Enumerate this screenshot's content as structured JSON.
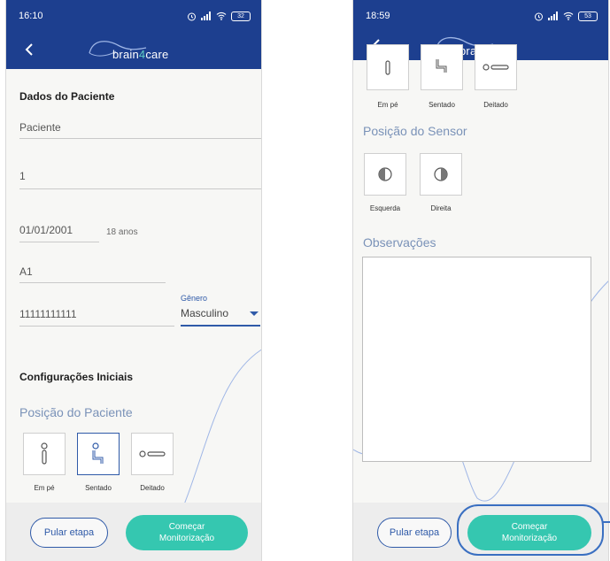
{
  "left": {
    "status": {
      "time": "16:10",
      "battery": "32"
    },
    "app": {
      "logo_prefix": "brain",
      "logo_accent": "4",
      "logo_suffix": "care"
    },
    "patient_section_title": "Dados do Paciente",
    "fields": {
      "name": "Paciente",
      "id": "1",
      "birthdate": "01/01/2001",
      "age": "18 anos",
      "room": "A1",
      "phone": "11111111111",
      "gender_label": "Gênero",
      "gender_value": "Masculino"
    },
    "config_title": "Configurações Iniciais",
    "position_title": "Posição do Paciente",
    "positions": [
      {
        "label": "Em pé",
        "icon": "standing-icon",
        "selected": false
      },
      {
        "label": "Sentado",
        "icon": "sitting-icon",
        "selected": true
      },
      {
        "label": "Deitado",
        "icon": "lying-icon",
        "selected": false
      }
    ],
    "buttons": {
      "skip": "Pular etapa",
      "start_line1": "Começar",
      "start_line2": "Monitorização"
    }
  },
  "right": {
    "status": {
      "time": "18:59",
      "battery": "53"
    },
    "app": {
      "logo_prefix": "brain",
      "logo_accent": "4",
      "logo_suffix": "care"
    },
    "positions": [
      {
        "label": "Em pé",
        "icon": "standing-icon"
      },
      {
        "label": "Sentado",
        "icon": "sitting-icon"
      },
      {
        "label": "Deitado",
        "icon": "lying-icon"
      }
    ],
    "sensor_title": "Posição do Sensor",
    "sensor_positions": [
      {
        "label": "Esquerda",
        "icon": "sensor-left-icon"
      },
      {
        "label": "Direita",
        "icon": "sensor-right-icon"
      }
    ],
    "observations_title": "Observações",
    "observations_value": "",
    "buttons": {
      "skip": "Pular etapa",
      "start_line1": "Começar",
      "start_line2": "Monitorização"
    }
  },
  "colors": {
    "header": "#1d3f8f",
    "accent": "#35c7b0",
    "primary": "#2f5aa8"
  }
}
